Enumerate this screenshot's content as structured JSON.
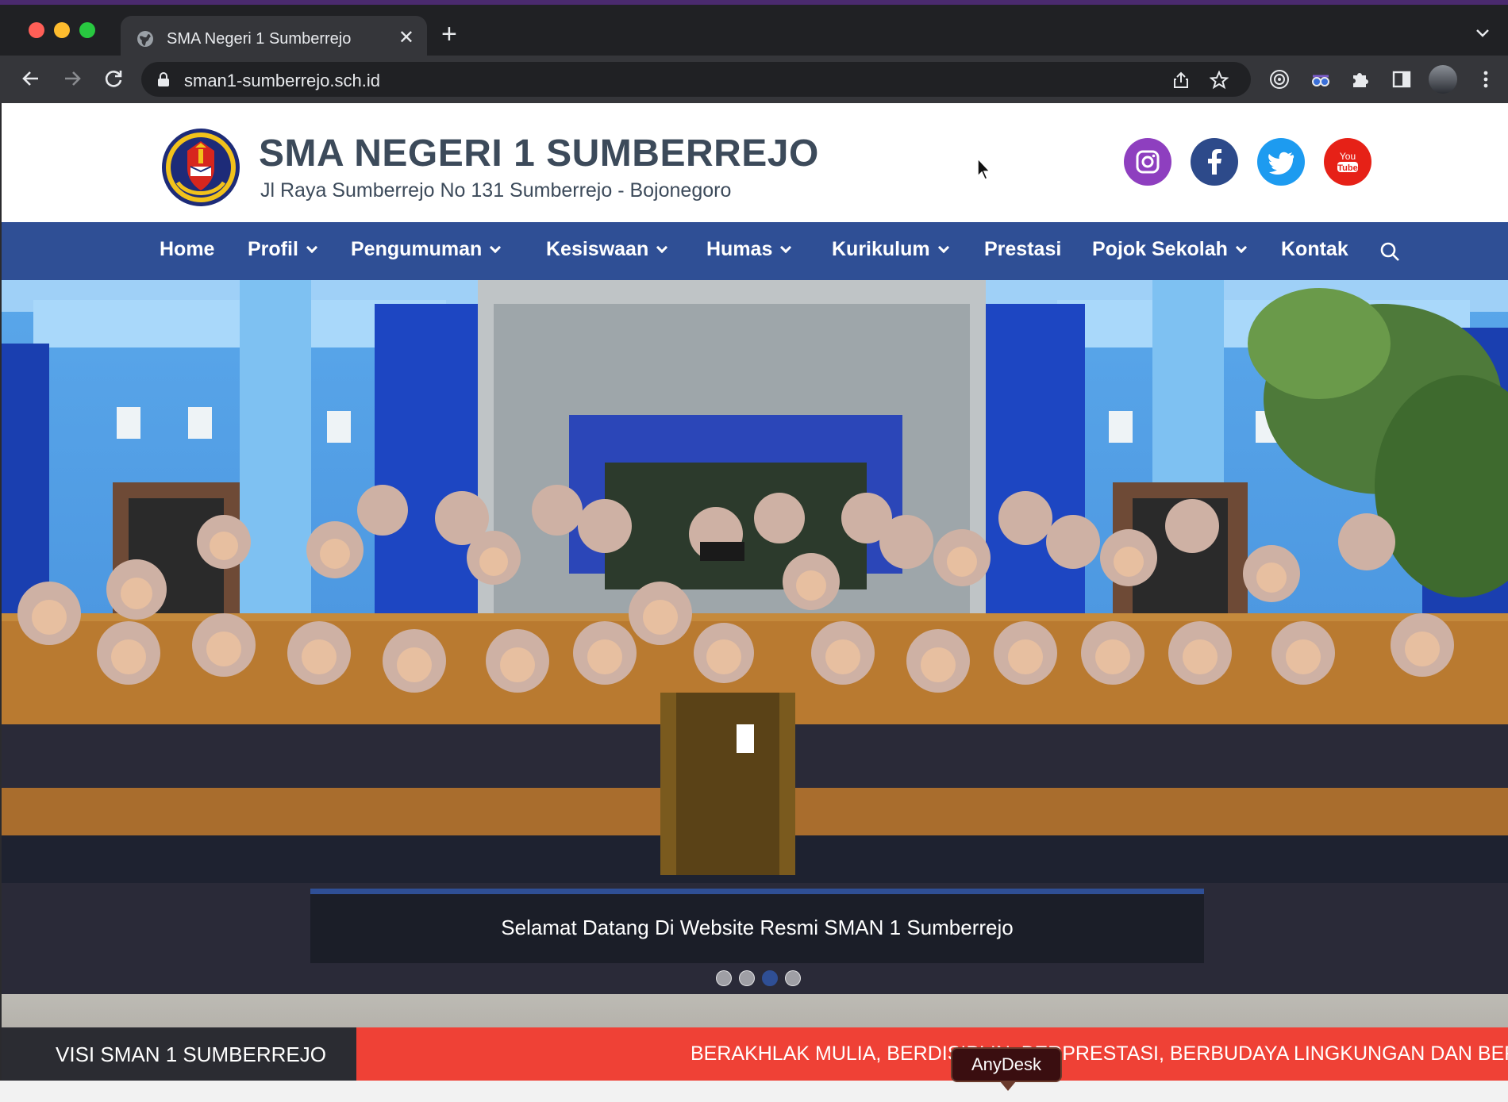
{
  "browser": {
    "tab_title": "SMA Negeri 1 Sumberrejo",
    "url": "sman1-sumberrejo.sch.id"
  },
  "site": {
    "name": "SMA NEGERI 1 SUMBERREJO",
    "address": "Jl Raya Sumberrejo No 131 Sumberrejo - Bojonegoro",
    "social": [
      "instagram-icon",
      "facebook-icon",
      "twitter-icon",
      "youtube-icon"
    ],
    "colors": {
      "nav": "#2f4f95",
      "ticker": "#ef4136",
      "ticker_label": "#2b2c32"
    }
  },
  "nav": {
    "items": [
      {
        "label": "Home"
      },
      {
        "label": "Profil"
      },
      {
        "label": "Pengumuman"
      },
      {
        "label": "Kesiswaan"
      },
      {
        "label": "Humas"
      },
      {
        "label": "Kurikulum"
      },
      {
        "label": "Prestasi"
      },
      {
        "label": "Pojok Sekolah"
      },
      {
        "label": "Kontak"
      }
    ]
  },
  "hero": {
    "caption": "Selamat Datang Di Website Resmi SMAN 1 Sumberrejo",
    "slide_count": 4,
    "active_slide": 3
  },
  "ticker": {
    "label": "VISI SMAN 1 SUMBERREJO",
    "text": "BERAKHLAK MULIA, BERDISIPLIN, BERPRESTASI, BERBUDAYA LINGKUNGAN DAN BERK"
  },
  "overlay": {
    "anydesk_label": "AnyDesk"
  }
}
